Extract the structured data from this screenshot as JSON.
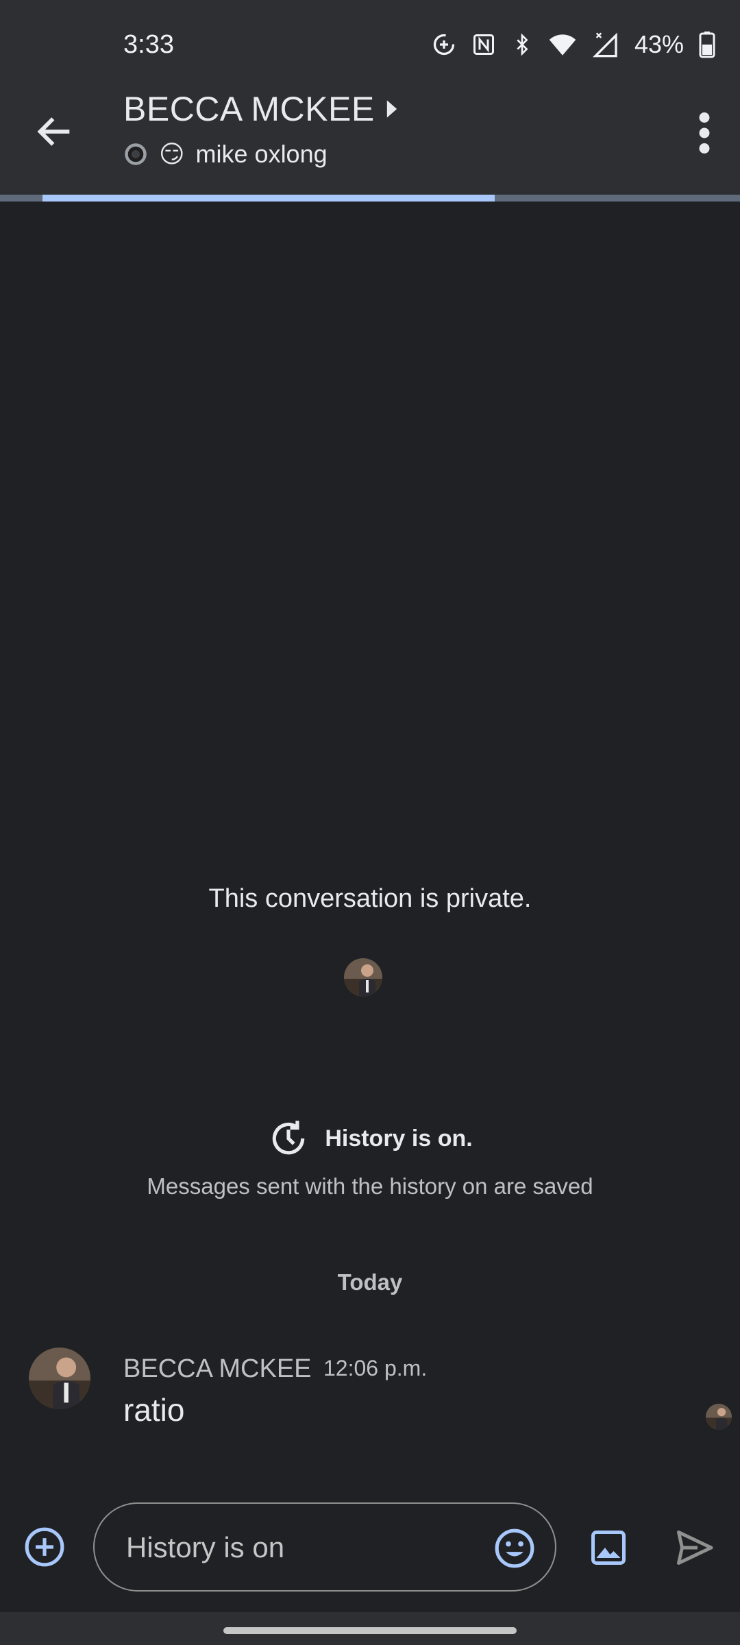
{
  "status_bar": {
    "time": "3:33",
    "battery": "43%"
  },
  "header": {
    "title": "BECCA MCKEE",
    "subtitle_emoji": "😏",
    "subtitle": "mike oxlong",
    "progress": 0.6
  },
  "conversation": {
    "private_notice": "This conversation is private.",
    "history_title": "History is on.",
    "history_desc": "Messages sent with the history on are saved",
    "date_divider": "Today"
  },
  "messages": [
    {
      "sender": "BECCA MCKEE",
      "time": "12:06 p.m.",
      "text": "ratio"
    }
  ],
  "composer": {
    "placeholder": "History is on"
  },
  "colors": {
    "accent": "#a8c7fa",
    "background": "#202124",
    "header": "#2d2f33"
  }
}
